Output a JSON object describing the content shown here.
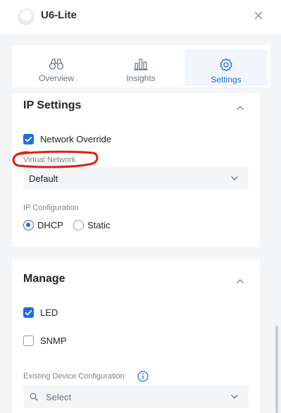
{
  "header": {
    "title": "U6-Lite"
  },
  "tabs": [
    {
      "label": "Overview",
      "icon": "binoculars-icon",
      "active": false
    },
    {
      "label": "Insights",
      "icon": "bar-chart-icon",
      "active": false
    },
    {
      "label": "Settings",
      "icon": "gear-icon",
      "active": true
    }
  ],
  "ip_settings": {
    "title": "IP Settings",
    "network_override": {
      "label": "Network Override",
      "checked": true
    },
    "virtual_network": {
      "label": "Virtual Network",
      "value": "Default"
    },
    "ip_configuration": {
      "label": "IP Configuration",
      "options": [
        {
          "label": "DHCP",
          "selected": true
        },
        {
          "label": "Static",
          "selected": false
        }
      ]
    }
  },
  "manage": {
    "title": "Manage",
    "led": {
      "label": "LED",
      "checked": true
    },
    "snmp": {
      "label": "SNMP",
      "checked": false
    },
    "existing_config": {
      "label": "Existing Device Configuration",
      "placeholder": "Select"
    }
  },
  "colors": {
    "accent": "#1a6fe0",
    "annotation": "#e0200f",
    "background": "#f4f5f6",
    "card": "#ffffff"
  }
}
